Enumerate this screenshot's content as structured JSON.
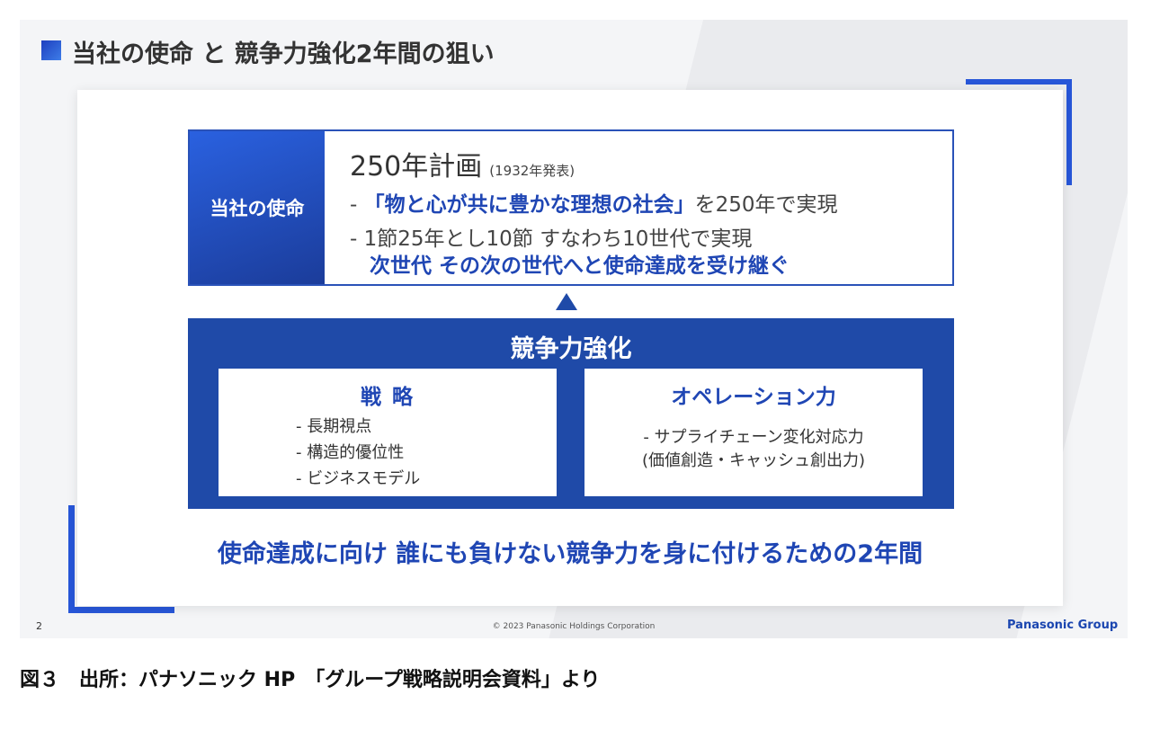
{
  "slide": {
    "title": "当社の使命 と 競争力強化2年間の狙い",
    "page_number": "2",
    "copyright": "© 2023 Panasonic Holdings Corporation",
    "brand": "Panasonic Group"
  },
  "mission": {
    "label": "当社の使命",
    "plan_title": "250年計画",
    "plan_note": "(1932年発表)",
    "bullet1_prefix": "- ",
    "bullet1_emphasis": "「物と心が共に豊かな理想の社会」",
    "bullet1_suffix": "を250年で実現",
    "bullet2": "- 1節25年とし10節 すなわち10世代で実現",
    "bullet2_sub": "次世代 その次の世代へと使命達成を受け継ぐ"
  },
  "competitiveness": {
    "title": "競争力強化",
    "strategy": {
      "heading": "戦 略",
      "items": [
        "- 長期視点",
        "- 構造的優位性",
        "- ビジネスモデル"
      ]
    },
    "operation": {
      "heading": "オペレーション力",
      "items": [
        "- サプライチェーン変化対応力",
        "(価値創造・キャッシュ創出力)"
      ]
    }
  },
  "tagline": "使命達成に向け 誰にも負けない競争力を身に付けるための2年間",
  "caption": "図３　出所：パナソニック HP　「グループ戦略説明会資料」より",
  "colors": {
    "accent_blue": "#1f4aa8",
    "text_blue": "#1f46b4"
  }
}
